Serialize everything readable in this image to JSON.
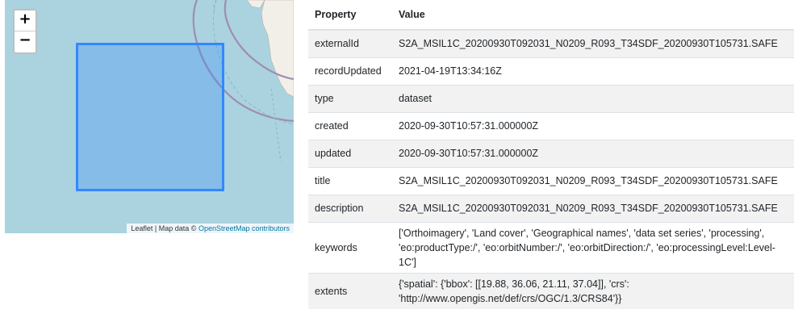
{
  "map": {
    "zoom_in_label": "+",
    "zoom_out_label": "−",
    "attribution_prefix": "Leaflet | Map data © ",
    "attribution_link": "OpenStreetMap contributors",
    "colors": {
      "water": "#aad3df",
      "land": "#f2efe9",
      "bbox_stroke": "#3388ff"
    }
  },
  "table": {
    "headers": {
      "property": "Property",
      "value": "Value"
    },
    "rows": [
      {
        "key": "externalId",
        "value": "S2A_MSIL1C_20200930T092031_N0209_R093_T34SDF_20200930T105731.SAFE"
      },
      {
        "key": "recordUpdated",
        "value": "2021-04-19T13:34:16Z"
      },
      {
        "key": "type",
        "value": "dataset"
      },
      {
        "key": "created",
        "value": "2020-09-30T10:57:31.000000Z"
      },
      {
        "key": "updated",
        "value": "2020-09-30T10:57:31.000000Z"
      },
      {
        "key": "title",
        "value": "S2A_MSIL1C_20200930T092031_N0209_R093_T34SDF_20200930T105731.SAFE"
      },
      {
        "key": "description",
        "value": "S2A_MSIL1C_20200930T092031_N0209_R093_T34SDF_20200930T105731.SAFE"
      },
      {
        "key": "keywords",
        "value": "['Orthoimagery', 'Land cover', 'Geographical names', 'data set series', 'processing', 'eo:productType:/', 'eo:orbitNumber:/', 'eo:orbitDirection:/', 'eo:processingLevel:Level-1C']"
      },
      {
        "key": "extents",
        "value": "{'spatial': {'bbox': [[19.88, 36.06, 21.11, 37.04]], 'crs': 'http://www.opengis.net/def/crs/OGC/1.3/CRS84'}}"
      }
    ]
  }
}
